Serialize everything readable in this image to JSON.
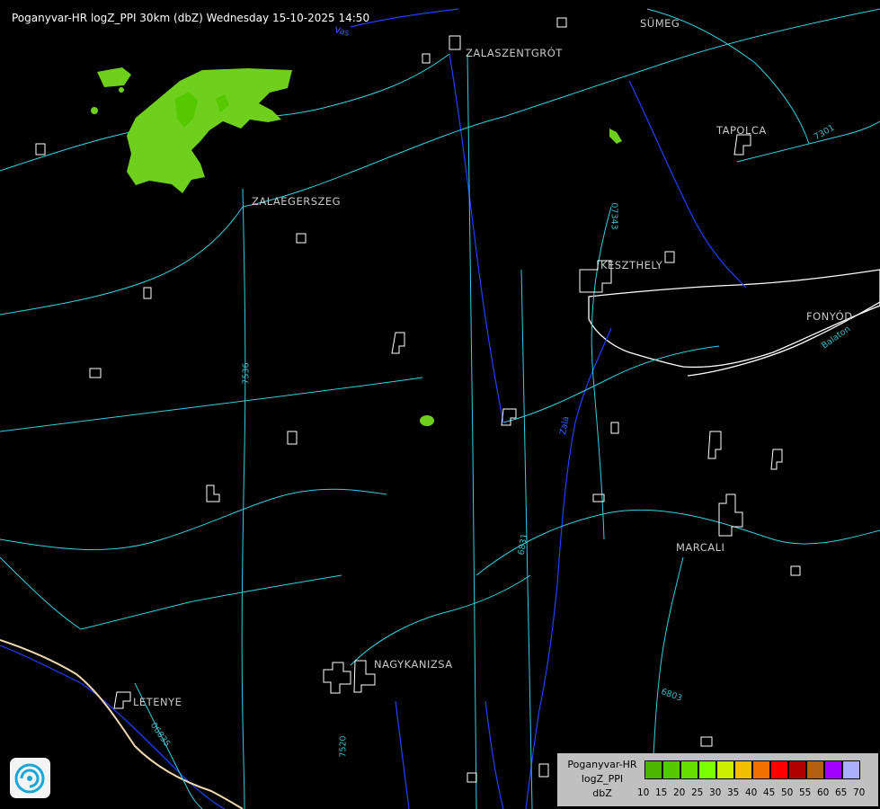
{
  "title": "Poganyvar-HR logZ_PPI 30km (dbZ) Wednesday 15-10-2025 14:50",
  "cities": [
    {
      "name": "SÜMEG"
    },
    {
      "name": "ZALASZENTGRÓT"
    },
    {
      "name": "TAPOLCA"
    },
    {
      "name": "ZALAEGERSZEG"
    },
    {
      "name": "KESZTHELY"
    },
    {
      "name": "FONYÓD"
    },
    {
      "name": "MARCALI"
    },
    {
      "name": "NAGYKANIZSA"
    },
    {
      "name": "LETENYE"
    }
  ],
  "road_labels": [
    "07343",
    "7301",
    "7536",
    "6831",
    "06835",
    "6803",
    "7520"
  ],
  "water_labels": [
    "Zala",
    "Vas",
    "Balaton"
  ],
  "legend": {
    "line1": "Poganyvar-HR",
    "line2": "logZ_PPI",
    "line3": "dbZ",
    "colors": [
      "#4bb500",
      "#55c800",
      "#66dd00",
      "#7fff00",
      "#ccee00",
      "#f0c000",
      "#f07000",
      "#ff0000",
      "#b00000",
      "#b06010",
      "#a000ff",
      "#aab0ff"
    ],
    "ticks": [
      "10",
      "15",
      "20",
      "25",
      "30",
      "35",
      "40",
      "45",
      "50",
      "55",
      "60",
      "65",
      "70"
    ]
  },
  "precip_color": "#6fcf1d",
  "core_color": "#55c800",
  "road_color": "#35d0e0",
  "border_color": "#ffffff",
  "river_color": "#2040ff"
}
